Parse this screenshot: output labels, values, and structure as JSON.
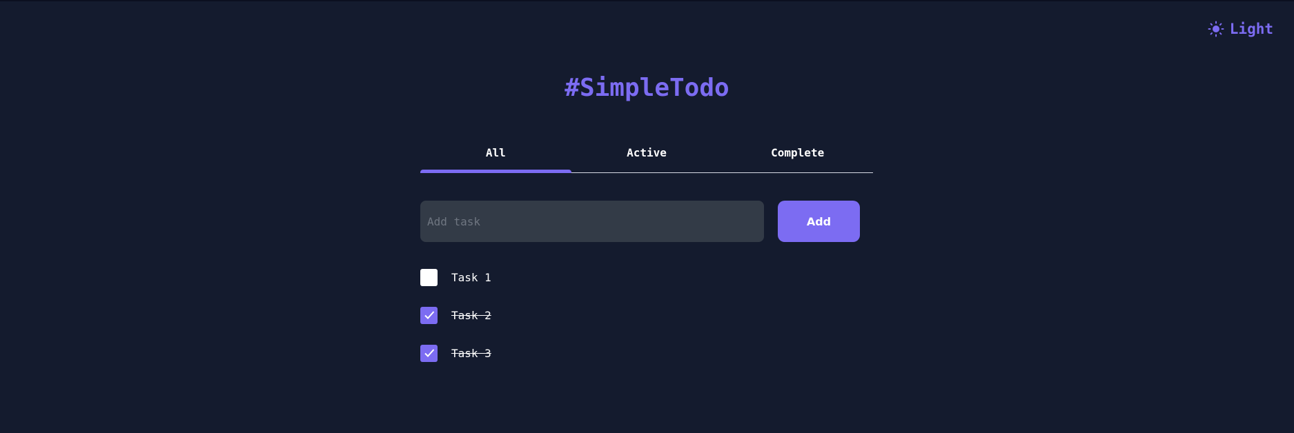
{
  "theme_toggle": {
    "label": "Light",
    "icon": "sun-icon"
  },
  "title": "#SimpleTodo",
  "tabs": [
    {
      "label": "All",
      "active": true
    },
    {
      "label": "Active",
      "active": false
    },
    {
      "label": "Complete",
      "active": false
    }
  ],
  "add_form": {
    "input_placeholder": "Add task",
    "input_value": "",
    "button_label": "Add"
  },
  "tasks": [
    {
      "label": "Task 1",
      "completed": false
    },
    {
      "label": "Task 2",
      "completed": true
    },
    {
      "label": "Task 3",
      "completed": true
    }
  ],
  "colors": {
    "background": "#141b2e",
    "accent": "#7c6cf2",
    "input_bg": "#333b47"
  }
}
